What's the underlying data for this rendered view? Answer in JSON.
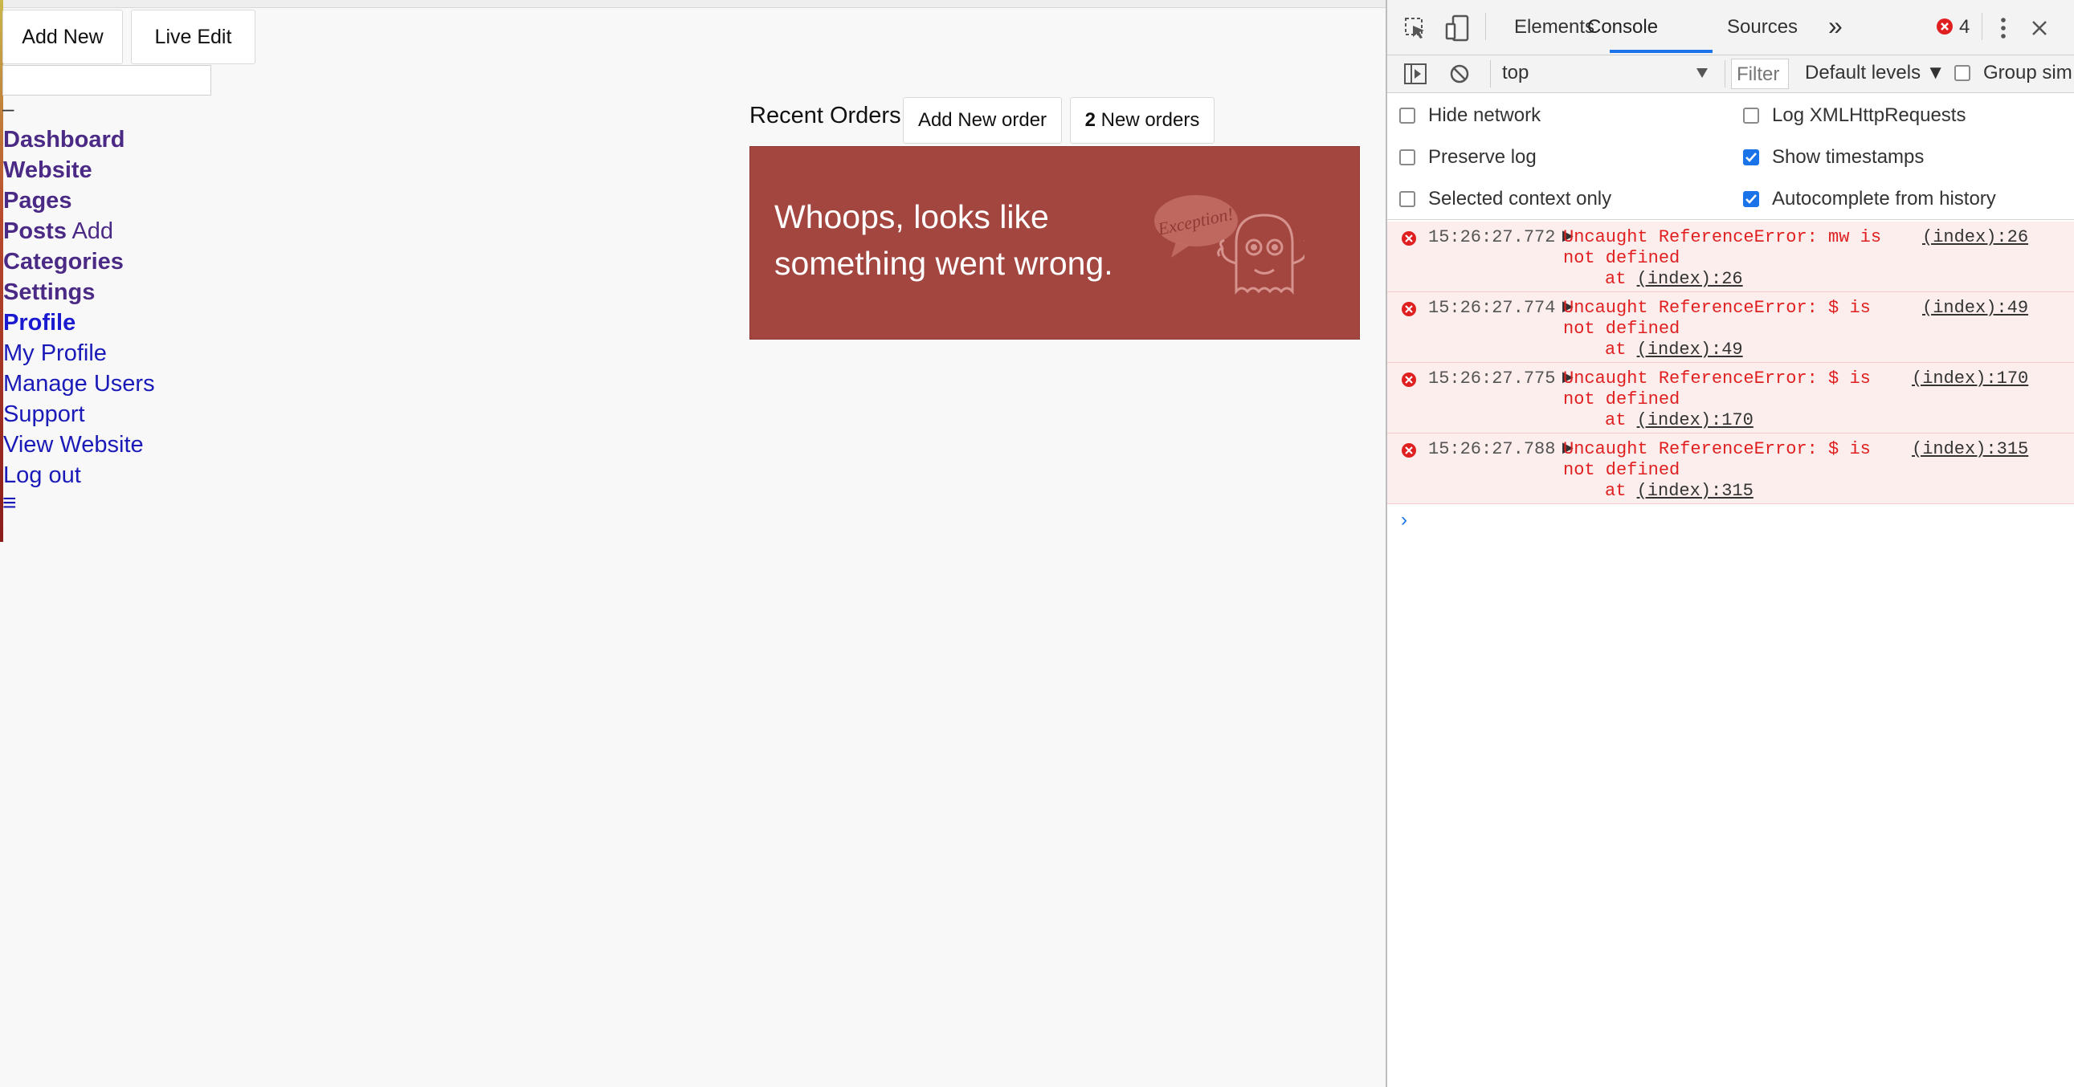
{
  "page": {
    "buttons": {
      "add_new": "Add New",
      "live_edit": "Live Edit"
    },
    "search": {
      "value": "",
      "placeholder": ""
    },
    "dash_mark": "–",
    "nav": {
      "dashboard": "Dashboard",
      "website": "Website",
      "pages": "Pages",
      "posts": "Posts",
      "posts_add": "Add",
      "categories": "Categories",
      "settings": "Settings",
      "profile": "Profile",
      "my_profile": "My Profile",
      "manage_users": "Manage Users",
      "support": "Support",
      "view_website": "View Website",
      "log_out": "Log out",
      "menu_icon": "≡"
    },
    "orders": {
      "title": "Recent Orders",
      "add_new_order": "Add New order",
      "new_orders_count": "2",
      "new_orders_label": " New orders"
    },
    "error": {
      "message": "Whoops, looks like something went wrong.",
      "bubble_text": "Exception!",
      "bg_color": "#a34640"
    }
  },
  "devtools": {
    "tabs": {
      "elements": "Elements",
      "console": "Console",
      "sources": "Sources",
      "more": "»"
    },
    "error_count": "4",
    "toolbar": {
      "context": "top",
      "filter_placeholder": "Filter",
      "levels": "Default levels ▼",
      "group_similar": "Group sim"
    },
    "settings": {
      "hide_network": "Hide network",
      "log_xhr": "Log XMLHttpRequests",
      "preserve_log": "Preserve log",
      "show_timestamps": "Show timestamps",
      "selected_context": "Selected context only",
      "autocomplete": "Autocomplete from history"
    },
    "logs": [
      {
        "time": "15:26:27.772",
        "msg": "Uncaught ReferenceError: mw is\nnot defined",
        "src": "(index):26",
        "at": "(index):26"
      },
      {
        "time": "15:26:27.774",
        "msg": "Uncaught ReferenceError: $ is\nnot defined",
        "src": "(index):49",
        "at": "(index):49"
      },
      {
        "time": "15:26:27.775",
        "msg": "Uncaught ReferenceError: $ is\nnot defined",
        "src": "(index):170",
        "at": "(index):170"
      },
      {
        "time": "15:26:27.788",
        "msg": "Uncaught ReferenceError: $ is\nnot defined",
        "src": "(index):315",
        "at": "(index):315"
      }
    ],
    "at_prefix": "at ",
    "prompt": "›",
    "accent_color": "#1a73e8",
    "error_color": "#e02020"
  }
}
